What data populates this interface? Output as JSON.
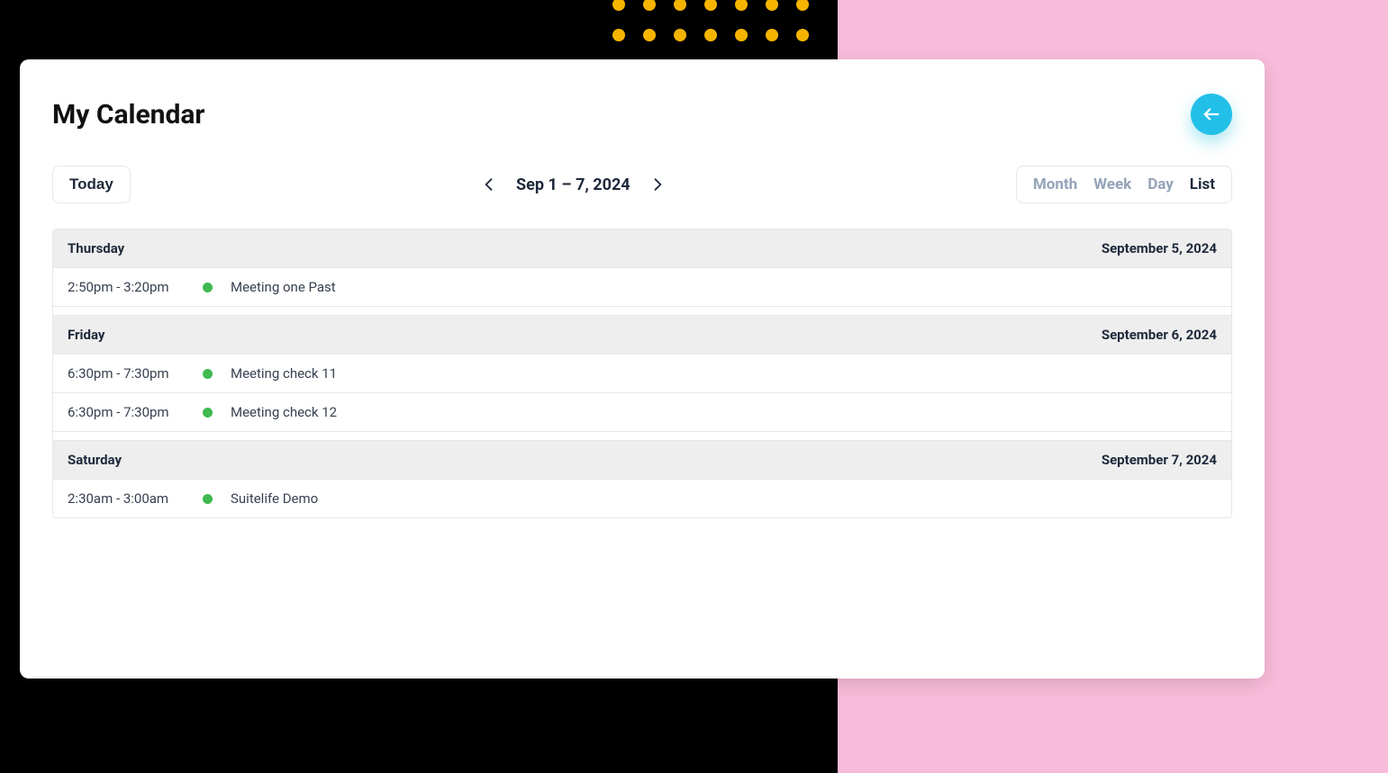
{
  "header": {
    "title": "My Calendar"
  },
  "toolbar": {
    "today_label": "Today",
    "date_range_label": "Sep 1 – 7, 2024",
    "views": {
      "month": "Month",
      "week": "Week",
      "day": "Day",
      "list": "List"
    },
    "active_view": "list"
  },
  "colors": {
    "event_dot": "#3FB950",
    "back_button": "#22C0E8"
  },
  "days": [
    {
      "weekday": "Thursday",
      "date_label": "September 5, 2024",
      "events": [
        {
          "time": "2:50pm - 3:20pm",
          "title": "Meeting one Past"
        }
      ]
    },
    {
      "weekday": "Friday",
      "date_label": "September 6, 2024",
      "events": [
        {
          "time": "6:30pm - 7:30pm",
          "title": "Meeting check 11"
        },
        {
          "time": "6:30pm - 7:30pm",
          "title": "Meeting check 12"
        }
      ]
    },
    {
      "weekday": "Saturday",
      "date_label": "September 7, 2024",
      "events": [
        {
          "time": "2:30am - 3:00am",
          "title": "Suitelife Demo"
        }
      ]
    }
  ]
}
